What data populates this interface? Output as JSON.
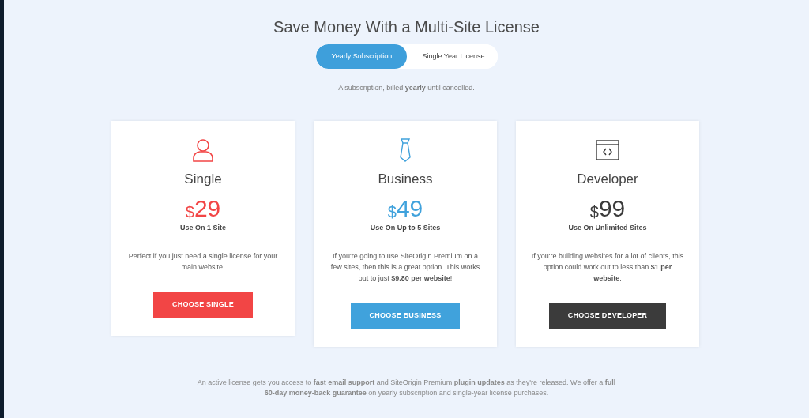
{
  "title": "Save Money With a Multi-Site License",
  "tabs": [
    {
      "label": "Yearly Subscription",
      "selected": true
    },
    {
      "label": "Single Year License",
      "selected": false
    }
  ],
  "billing_note": "A subscription, billed **yearly** until cancelled.",
  "plans": [
    {
      "kind": "person",
      "name": "Single",
      "currency": "$",
      "amount": "29",
      "usage": "Use On 1 Site",
      "description": "Perfect if you just need a single license for your main website.",
      "button": "CHOOSE SINGLE",
      "color": "#f24545"
    },
    {
      "kind": "tie",
      "name": "Business",
      "currency": "$",
      "amount": "49",
      "usage": "Use On Up to 5 Sites",
      "description": "If you're going to use SiteOrigin Premium on a few sites, then this is a great option. This works out to just **$9.80 per website**!",
      "button": "CHOOSE BUSINESS",
      "color": "#40a2dc"
    },
    {
      "kind": "code",
      "name": "Developer",
      "currency": "$",
      "amount": "99",
      "usage": "Use On Unlimited Sites",
      "description": "If you're building websites for a lot of clients, this option could work out to less than **$1 per website**.",
      "button": "CHOOSE DEVELOPER",
      "color": "#3b3b3b"
    }
  ],
  "footer": "An active license gets you access to **fast email support** and SiteOrigin Premium **plugin updates** as they're released. We offer a **full 60-day money-back guarantee** on yearly subscription and single-year license purchases."
}
